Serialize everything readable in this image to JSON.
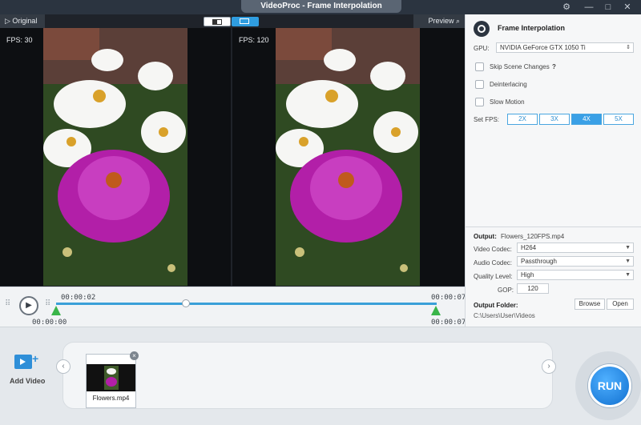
{
  "app": {
    "title": "VideoProc - Frame Interpolation"
  },
  "window": {
    "settings_icon": "gear-icon",
    "minimize": "—",
    "maximize": "□",
    "close": "✕"
  },
  "preview": {
    "original_label": "Original",
    "preview_label": "Preview",
    "left_fps": "FPS: 30",
    "right_fps": "FPS: 120"
  },
  "timeline": {
    "current_time": "00:00:02",
    "start_time": "00:00:00",
    "end_time_top": "00:00:07",
    "end_time_bottom": "00:00:07",
    "progress": 0.34
  },
  "settings": {
    "title": "Frame Interpolation",
    "gpu_label": "GPU:",
    "gpu_value": "NVIDIA GeForce GTX 1050 Ti",
    "skip_scene_changes": "Skip Scene Changes",
    "help_mark": "?",
    "deinterlacing": "Deinterlacing",
    "slow_motion": "Slow Motion",
    "set_fps_label": "Set FPS:",
    "fps_options": [
      "2X",
      "3X",
      "4X",
      "5X"
    ],
    "fps_selected": "4X",
    "output_label": "Output:",
    "output_file": "Flowers_120FPS.mp4",
    "video_codec_label": "Video Codec:",
    "video_codec": "H264",
    "audio_codec_label": "Audio Codec:",
    "audio_codec": "Passthrough",
    "quality_label": "Quality Level:",
    "quality": "High",
    "gop_label": "GOP:",
    "gop": "120",
    "output_folder_label": "Output Folder:",
    "browse": "Browse",
    "open": "Open",
    "output_path": "C:\\Users\\User\\Videos"
  },
  "bottom": {
    "add_video": "Add Video",
    "file_name": "Flowers.mp4",
    "run": "RUN"
  },
  "colors": {
    "accent": "#3aa0e6",
    "titlebar": "#2b3440",
    "marker": "#3ab54a"
  }
}
